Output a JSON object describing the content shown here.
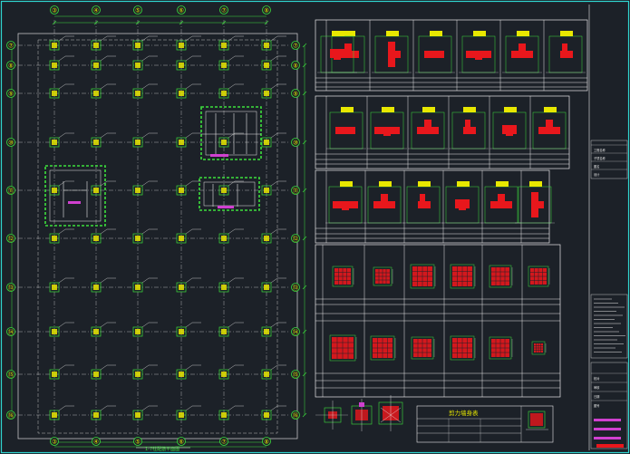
{
  "drawing": {
    "background": "#1c2128",
    "frame_color": "#2fd4cf",
    "line_color": "#e8e8e8",
    "column_color": "#e8e800",
    "rebar_color": "#3ce03c",
    "section_fill": "#e8171c",
    "accent_color": "#d040d0"
  },
  "plan": {
    "top_axes": [
      "③",
      "④",
      "⑤",
      "⑥",
      "⑦",
      "⑧"
    ],
    "bottom_axes": [
      "③",
      "④",
      "⑤",
      "⑥",
      "⑦",
      "⑧"
    ],
    "left_axes": [
      "⑦",
      "⑧",
      "⑨",
      "⑩",
      "⑪",
      "⑫",
      "⑬",
      "⑭",
      "⑮",
      "⑯"
    ],
    "right_axes": [
      "⑦",
      "⑧",
      "⑨",
      "⑩",
      "⑪",
      "⑫",
      "⑬",
      "⑭",
      "⑮",
      "⑯"
    ],
    "caption": "1-7柱配筋平面图"
  },
  "schedule": {
    "title": "剪力墙身表"
  },
  "title_block": {
    "rows": [
      "工程名称",
      "子项名称",
      "图名",
      "设计",
      "校对",
      "审核",
      "日期",
      "图号"
    ]
  }
}
